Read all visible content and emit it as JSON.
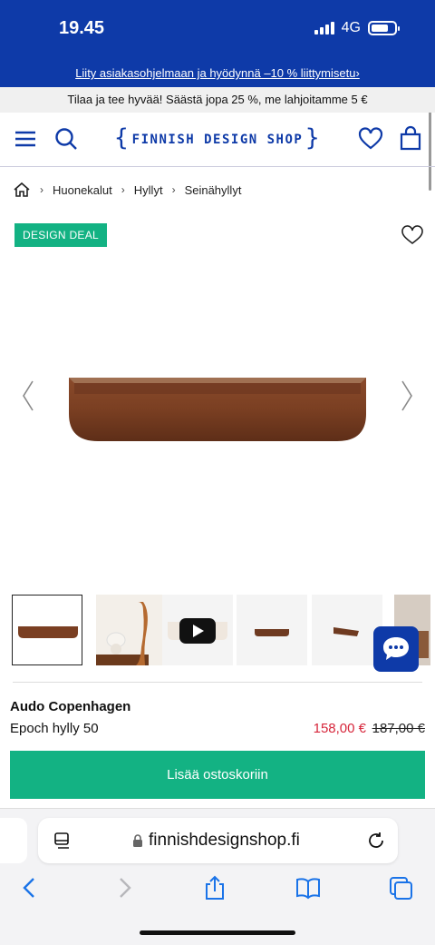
{
  "status_bar": {
    "time": "19.45",
    "network": "4G",
    "battery_level": 0.75
  },
  "promo": {
    "link_text": "Liity asiakasohjelmaan ja hyödynnä –10 % liittymisetu›"
  },
  "offer": {
    "text": "Tilaa ja tee hyvää! Säästä jopa 25 %, me lahjoitamme 5 €"
  },
  "header": {
    "logo_text": "FINNISH DESIGN SHOP",
    "icons": [
      "menu-icon",
      "search-icon",
      "heart-icon",
      "bag-icon"
    ],
    "brand_color": "#0e3aa8"
  },
  "breadcrumb": {
    "items": [
      "Huonekalut",
      "Hyllyt",
      "Seinähyllyt"
    ],
    "separator": "›"
  },
  "product": {
    "badge": "DESIGN DEAL",
    "badge_color": "#13b283",
    "brand": "Audo Copenhagen",
    "name": "Epoch hylly 50",
    "price": "158,00 €",
    "old_price": "187,00 €",
    "price_color": "#d6263b",
    "cart_label": "Lisää ostoskoriin",
    "thumbnails": [
      "shelf-front",
      "lamp-and-figure",
      "video",
      "shelf-small",
      "shelf-side",
      "partial"
    ]
  },
  "browser": {
    "url": "finnishdesignshop.fi",
    "icons": [
      "back-icon",
      "forward-icon",
      "share-icon",
      "bookmarks-icon",
      "tabs-icon"
    ]
  }
}
